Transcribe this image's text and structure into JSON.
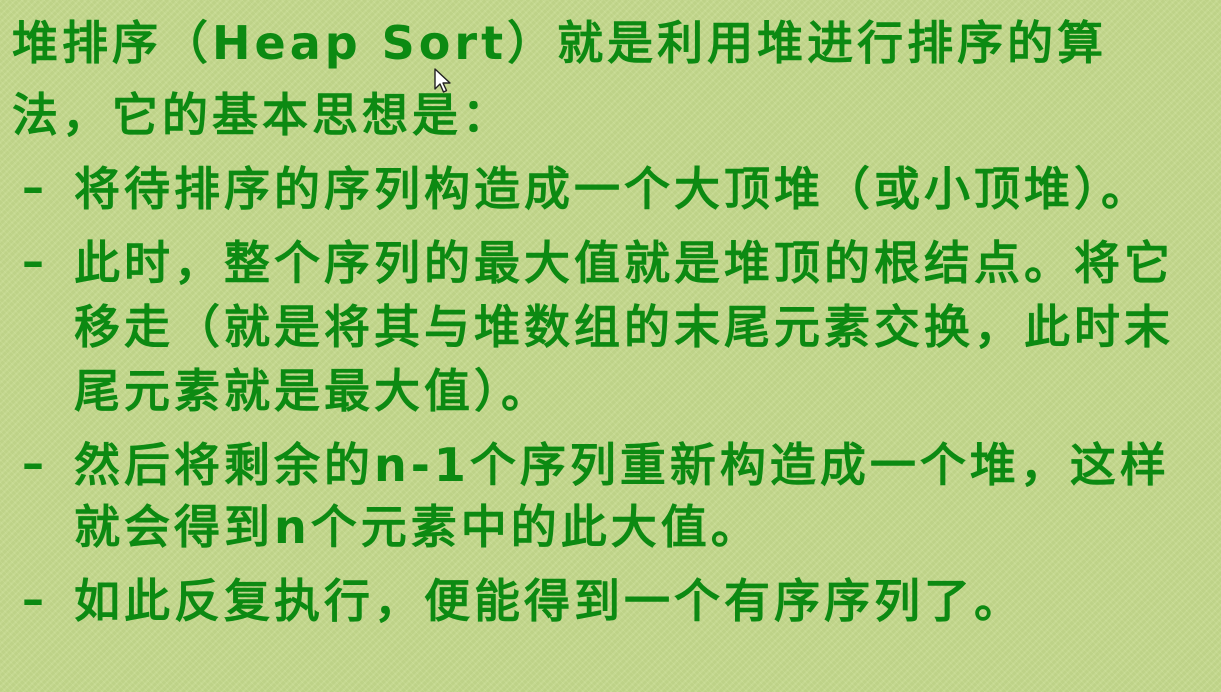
{
  "slide": {
    "intro_line1": "堆排序（Heap Sort）就是利用堆进行排序的算",
    "intro_line2": "法，它的基本思想是：",
    "bullet_marker": "–",
    "bullets": [
      {
        "lines": [
          "将待排序的序列构造成一个大顶堆（或小顶堆）。"
        ]
      },
      {
        "lines": [
          "此时，整个序列的最大值就是堆顶的根结点。将它",
          "移走（就是将其与堆数组的末尾元素交换，此时末",
          "尾元素就是最大值）。"
        ]
      },
      {
        "lines": [
          "然后将剩余的n-1个序列重新构造成一个堆，这样",
          "就会得到n个元素中的此大值。"
        ]
      },
      {
        "lines": [
          "如此反复执行，便能得到一个有序序列了。"
        ]
      }
    ]
  },
  "colors": {
    "background": "#c5da8d",
    "text": "#0c8a12"
  },
  "icons": {
    "cursor": "mouse-pointer-icon"
  }
}
